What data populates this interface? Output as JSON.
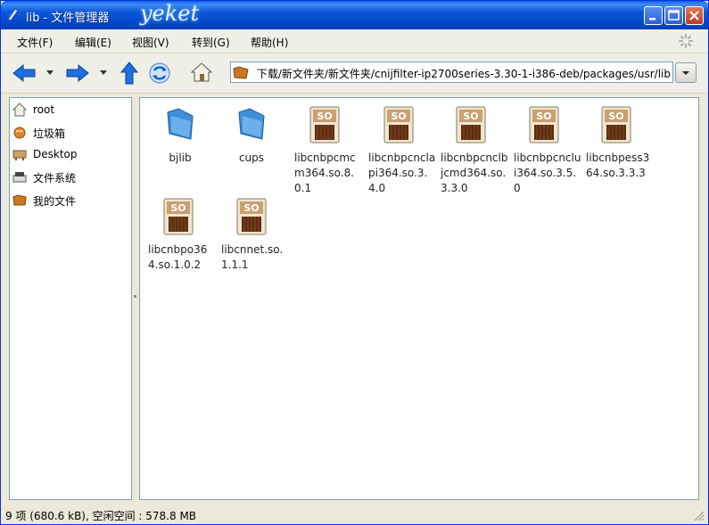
{
  "window": {
    "title": "lib - 文件管理器",
    "logo": "yeket",
    "colors": {
      "titlebar": "#0148c9",
      "menubar": "#f0efe7",
      "close": "#c4381c"
    }
  },
  "menu": [
    {
      "label": "文件(F)"
    },
    {
      "label": "编辑(E)"
    },
    {
      "label": "视图(V)"
    },
    {
      "label": "转到(G)"
    },
    {
      "label": "帮助(H)"
    }
  ],
  "toolbar": {
    "buttons": [
      "back-arrow-icon",
      "forward-arrow-icon",
      "up-arrow-icon",
      "reload-icon",
      "home-icon"
    ],
    "location": "下载/新文件夹/新文件夹/cnijfilter-ip2700series-3.30-1-i386-deb/packages/usr/lib"
  },
  "sidebar": {
    "items": [
      {
        "label": "root",
        "icon": "home-icon"
      },
      {
        "label": "垃圾箱",
        "icon": "trash-icon"
      },
      {
        "label": "Desktop",
        "icon": "desktop-icon"
      },
      {
        "label": "文件系统",
        "icon": "drive-icon"
      },
      {
        "label": "我的文件",
        "icon": "folder-icon"
      }
    ]
  },
  "files": [
    {
      "name": "bjlib",
      "type": "folder"
    },
    {
      "name": "cups",
      "type": "folder"
    },
    {
      "name": "libcnbpcmcm364.so.8.0.1",
      "type": "so"
    },
    {
      "name": "libcnbpcnclapi364.so.3.4.0",
      "type": "so"
    },
    {
      "name": "libcnbpcnclbjcmd364.so.3.3.0",
      "type": "so"
    },
    {
      "name": "libcnbpcnclui364.so.3.5.0",
      "type": "so"
    },
    {
      "name": "libcnbpess364.so.3.3.3",
      "type": "so"
    },
    {
      "name": "libcnbpo364.so.1.0.2",
      "type": "so"
    },
    {
      "name": "libcnnet.so.1.1.1",
      "type": "so"
    }
  ],
  "status": {
    "text": "9 项 (680.6 kB), 空闲空间 : 578.8 MB"
  }
}
